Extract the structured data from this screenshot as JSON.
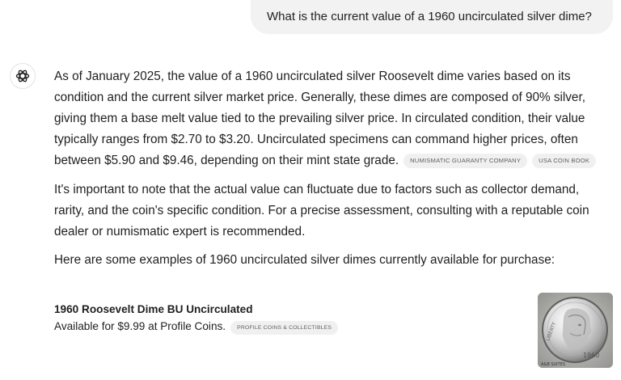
{
  "user_message": "What is the current value of a 1960 uncirculated silver dime?",
  "answer": {
    "paragraph1": "As of January 2025, the value of a 1960 uncirculated silver Roosevelt dime varies based on its condition and the current silver market price. Generally, these dimes are composed of 90% silver, giving them a base melt value tied to the prevailing silver price. In circulated condition, their value typically ranges from $2.70 to $3.20. Uncirculated specimens can command higher prices, often between $5.90 and $9.46, depending on their mint state grade.",
    "sources": [
      "NUMISMATIC GUARANTY COMPANY",
      "USA COIN BOOK"
    ],
    "paragraph2": "It's important to note that the actual value can fluctuate due to factors such as collector demand, rarity, and the coin's specific condition. For a precise assessment, consulting with a reputable coin dealer or numismatic expert is recommended.",
    "paragraph3": "Here are some examples of 1960 uncirculated silver dimes currently available for purchase:"
  },
  "product": {
    "title": "1960 Roosevelt Dime BU Uncirculated",
    "description": "Available for $9.99 at Profile Coins.",
    "source": "PROFILE COINS & COLLECTIBLES",
    "image_year": "1960",
    "image_watermark": "A&B SUITES"
  },
  "icons": {
    "assistant": "openai-logo-icon"
  }
}
